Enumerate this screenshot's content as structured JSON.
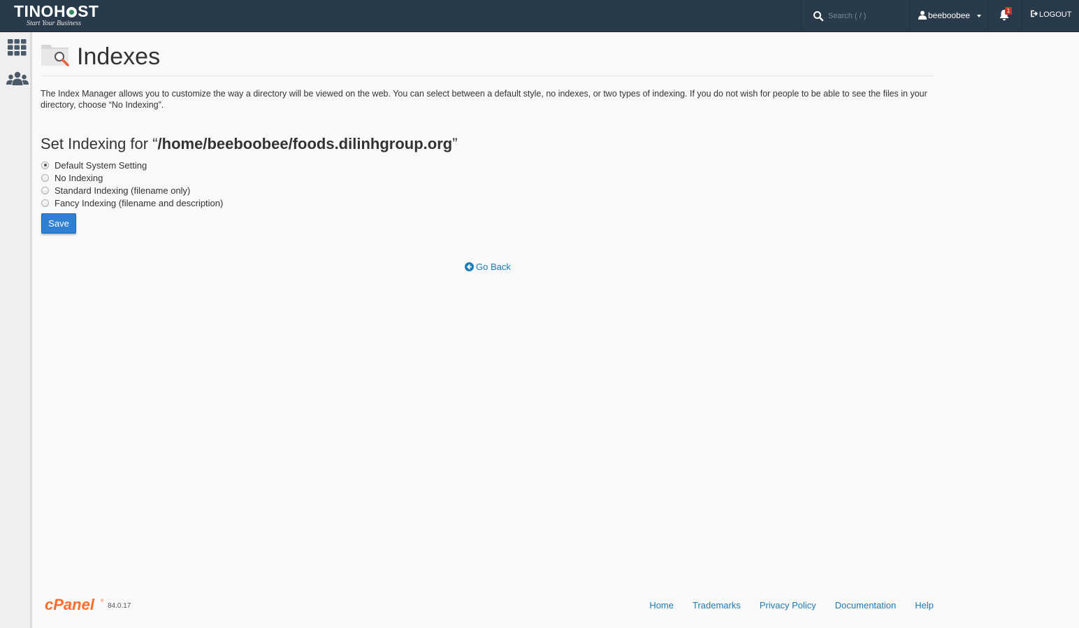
{
  "brand": {
    "name_part1": "TINOH",
    "name_part2": "ST",
    "tagline": "Start Your Business"
  },
  "search": {
    "placeholder": "Search ( / )"
  },
  "user": {
    "name": "beeboobee"
  },
  "notifications": {
    "count": "1"
  },
  "logout": {
    "label": "LOGOUT"
  },
  "page": {
    "title": "Indexes",
    "description": "The Index Manager allows you to customize the way a directory will be viewed on the web. You can select between a default style, no indexes, or two types of indexing. If you do not wish for people to be able to see the files in your directory, choose “No Indexing”.",
    "set_indexing_prefix": "Set Indexing for “",
    "path": "/home/beeboobee/foods.dilinhgroup.org",
    "set_indexing_suffix": "”"
  },
  "options": [
    {
      "label": "Default System Setting",
      "checked": true
    },
    {
      "label": "No Indexing",
      "checked": false
    },
    {
      "label": "Standard Indexing (filename only)",
      "checked": false
    },
    {
      "label": "Fancy Indexing (filename and description)",
      "checked": false
    }
  ],
  "actions": {
    "save_label": "Save",
    "go_back_label": "Go Back"
  },
  "footer": {
    "logo_text": "cPanel",
    "version": "84.0.17",
    "links": [
      "Home",
      "Trademarks",
      "Privacy Policy",
      "Documentation",
      "Help"
    ]
  },
  "colors": {
    "topbar": "#293a4a",
    "link": "#1b7bb5",
    "button": "#2f7fd3",
    "cpanel_orange": "#ff6c2c"
  },
  "icons": [
    "search-icon",
    "user-icon",
    "bell-icon",
    "logout-icon",
    "apps-grid-icon",
    "users-icon",
    "folder-search-icon",
    "arrow-left-circle-icon"
  ]
}
